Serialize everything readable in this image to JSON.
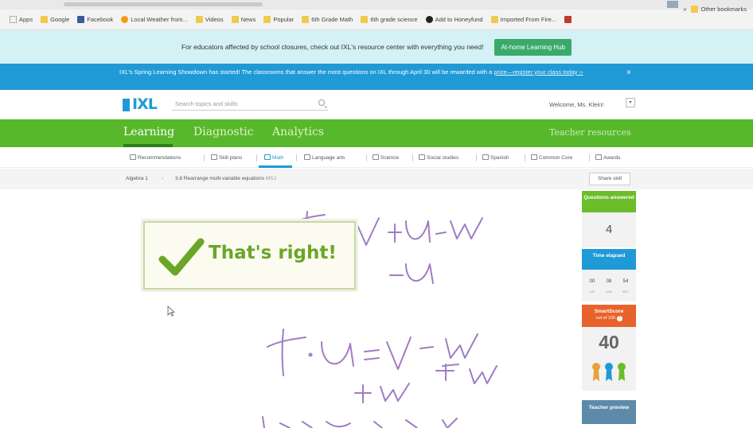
{
  "bookmarks": {
    "items": [
      {
        "label": "Apps",
        "icon": "apps-grid-icon"
      },
      {
        "label": "Google",
        "icon": "folder-icon"
      },
      {
        "label": "Facebook",
        "icon": "facebook-icon"
      },
      {
        "label": "Local Weather from...",
        "icon": "weather-icon"
      },
      {
        "label": "Videos",
        "icon": "folder-icon"
      },
      {
        "label": "News",
        "icon": "folder-icon"
      },
      {
        "label": "Popular",
        "icon": "folder-icon"
      },
      {
        "label": "6th Grade Math",
        "icon": "folder-icon"
      },
      {
        "label": "6th grade science",
        "icon": "folder-icon"
      },
      {
        "label": "Add to Honeyfund",
        "icon": "honeyfund-icon"
      },
      {
        "label": "Imported From Fire...",
        "icon": "folder-icon"
      }
    ],
    "other": "Other bookmarks"
  },
  "educator_banner": {
    "text": "For educators affected by school closures, check out IXL's resource center with everything you need!",
    "button": "At-home Learning Hub"
  },
  "showdown_banner": {
    "text": "IXL's Spring Learning Showdown has started! The classrooms that answer the most questions on IXL through April 30 will be rewarded with a",
    "link": "prize—register your class today ››",
    "close": "×"
  },
  "header": {
    "logo": "IXL",
    "search_placeholder": "Search topics and skills",
    "welcome": "Welcome, Ms. Klein!",
    "dropdown": "▾"
  },
  "green_nav": {
    "items": [
      "Learning",
      "Diagnostic",
      "Analytics"
    ],
    "teacher_resources": "Teacher resources"
  },
  "subject_nav": {
    "items": [
      "Recommendations",
      "Skill plans",
      "Math",
      "Language arts",
      "Science",
      "Social studies",
      "Spanish",
      "Common Core",
      "Awards"
    ]
  },
  "breadcrumb": {
    "course": "Algebra 1",
    "skill": "3.8 Rearrange multi-variable equations",
    "code": "MSJ",
    "share": "Share skill"
  },
  "feedback": {
    "text": "That's right!"
  },
  "stats": {
    "questions_label": "Questions answered",
    "questions_value": "4",
    "time_label": "Time elapsed",
    "time": {
      "hr": "00",
      "min": "08",
      "sec": "54"
    },
    "time_caps": {
      "hr": "HR",
      "min": "MIN",
      "sec": "SEC"
    },
    "smartscore_label": "SmartScore",
    "smartscore_sub": "out of 100",
    "smartscore_value": "40",
    "teacher_preview": "Teacher preview"
  },
  "colors": {
    "green": "#58b82c",
    "blue": "#1f9ad6",
    "orange": "#e8622c",
    "ink": "#9b6bbd"
  }
}
